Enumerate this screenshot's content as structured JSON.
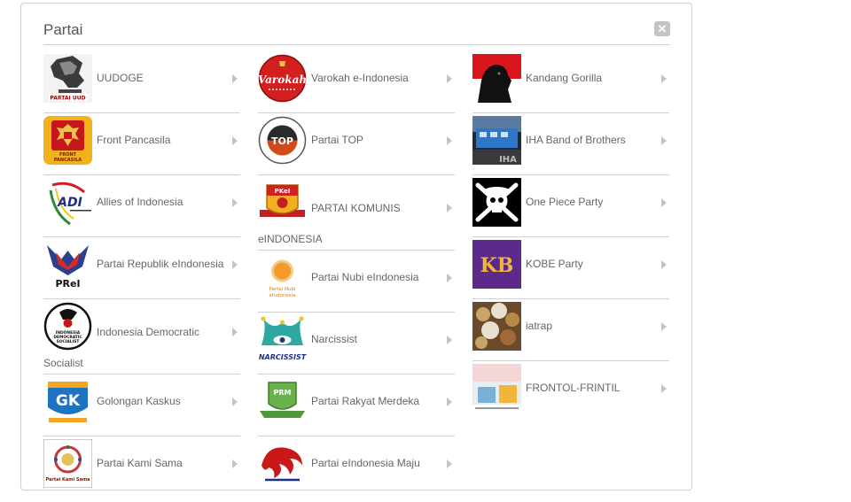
{
  "panel": {
    "title": "Partai"
  },
  "columns": [
    {
      "items": [
        {
          "label": "UUDOGE",
          "icon": "uudoge-logo-icon"
        },
        {
          "label": "Front Pancasila",
          "icon": "front-pancasila-logo-icon"
        },
        {
          "label": "Allies of Indonesia",
          "icon": "allies-of-indonesia-logo-icon"
        },
        {
          "label": "Partai Republik eIndonesia",
          "icon": "partai-republik-logo-icon"
        },
        {
          "label": "Indonesia Democratic Socialist",
          "icon": "indonesia-democratic-socialist-logo-icon"
        },
        {
          "label": "Golongan Kaskus",
          "icon": "golongan-kaskus-logo-icon"
        },
        {
          "label": "Partai Kami Sama",
          "icon": "partai-kami-sama-logo-icon"
        }
      ]
    },
    {
      "items": [
        {
          "label": "Varokah e-Indonesia",
          "icon": "varokah-logo-icon"
        },
        {
          "label": "Partai TOP",
          "icon": "partai-top-logo-icon"
        },
        {
          "label": "PARTAI KOMUNIS eINDONESIA",
          "icon": "partai-komunis-logo-icon"
        },
        {
          "label": "Partai Nubi eIndonesia",
          "icon": "partai-nubi-logo-icon"
        },
        {
          "label": "Narcissist",
          "icon": "narcissist-logo-icon"
        },
        {
          "label": "Partai Rakyat Merdeka",
          "icon": "partai-rakyat-merdeka-logo-icon"
        },
        {
          "label": "Partai eIndonesia Maju",
          "icon": "partai-eindonesia-maju-logo-icon"
        }
      ]
    },
    {
      "items": [
        {
          "label": "Kandang Gorilla",
          "icon": "kandang-gorilla-logo-icon"
        },
        {
          "label": "IHA Band of Brothers",
          "icon": "iha-band-of-brothers-logo-icon"
        },
        {
          "label": "One Piece Party",
          "icon": "one-piece-party-logo-icon"
        },
        {
          "label": "KOBE Party",
          "icon": "kobe-party-logo-icon"
        },
        {
          "label": "iatrap",
          "icon": "iatrap-logo-icon"
        },
        {
          "label": "FRONTOL-FRINTIL",
          "icon": "frontol-frintil-logo-icon"
        }
      ]
    }
  ],
  "logo_text": {
    "uudoge": "PARTAI UUD",
    "front_pancasila": "FRONT PANCASILA",
    "allies": "ADI",
    "prei": "PReI",
    "ids": "INDONESIA DEMOCRATIC SOCIALIST",
    "gk": "GK",
    "kami_sama": "Partai Kami Sama",
    "varokah": "Varokah",
    "top": "TOP",
    "pkei": "PKeI",
    "nubi": "Partai Nubi eIndonesia",
    "narcissist": "NARCISSIST",
    "prm": "PRM",
    "kobe": "KB"
  },
  "colors": {
    "border": "#cfcfcf",
    "text": "#666666",
    "title": "#555555",
    "chevron": "#c4c4c4"
  }
}
